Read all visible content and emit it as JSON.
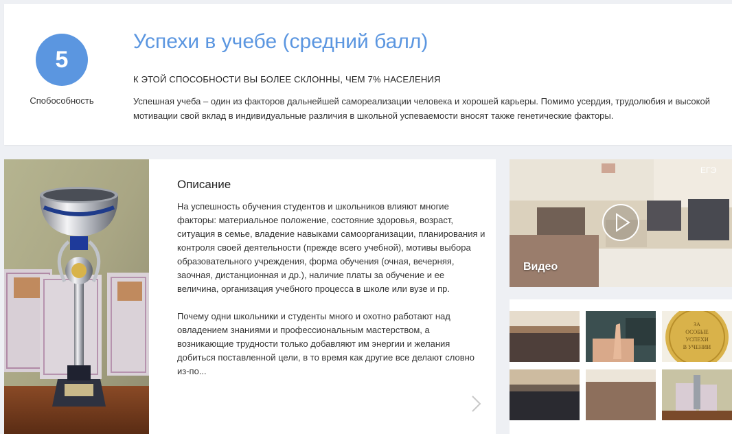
{
  "header": {
    "score": "5",
    "score_label": "Спобособность",
    "title": "Успехи в учебе (средний балл)",
    "subtitle": "К ЭТОЙ СПОСОБНОСТИ ВЫ БОЛЕЕ СКЛОННЫ, ЧЕМ 7% НАСЕЛЕНИЯ",
    "summary": "Успешная учеба – один из факторов дальнейшей самореализации человека и хорошей карьеры. Помимо усердия, трудолюбия и высокой мотивации свой вклад в индивидуальные различия в школьной успеваемости вносят также генетические факторы."
  },
  "description": {
    "title": "Описание",
    "paragraph1": "На успешность обучения студентов и школьников влияют многие факторы: материальное положение, состояние здоровья, возраст, ситуация в семье, владение навыками самоорганизации, планирования и контроля своей деятельности (прежде всего учебной), мотивы выбора образовательного учреждения, форма обучения (очная, вечерняя, заочная, дистанционная и др.), наличие платы за обучение и ее величина, организация учебного процесса в школе или вузе и пр.",
    "paragraph2": "Почему одни школьники и студенты много и охотно работают над овладением знаниями и профессиональным мастерством, а возникающие трудности только добавляют им энергии и желания добиться поставленной цели, в то время как другие все делают словно из-по..."
  },
  "video": {
    "label": "Видео",
    "watermark": "ЕГЭ"
  },
  "gallery": {
    "medal_text": [
      "ЗА",
      "ОСОБЫЕ",
      "УСПЕХИ",
      "В УЧЕНИИ"
    ]
  },
  "colors": {
    "accent": "#5b96e0",
    "background": "#eef0f4",
    "card": "#ffffff"
  },
  "icons": {
    "play": "play-icon",
    "next": "chevron-right-icon"
  }
}
